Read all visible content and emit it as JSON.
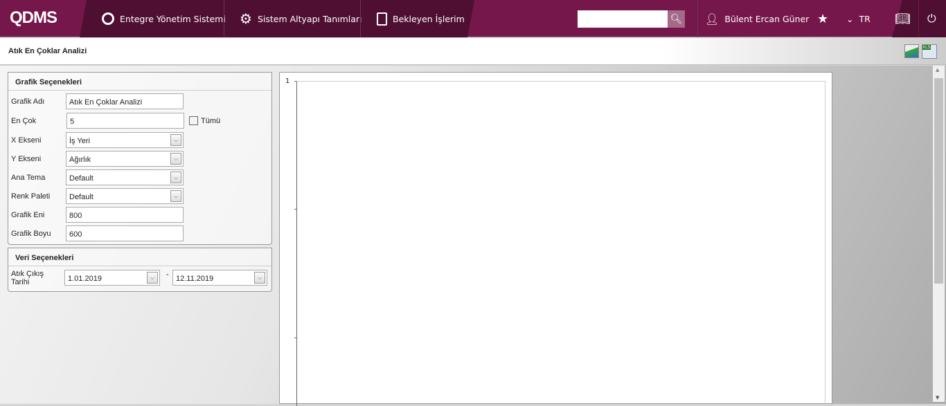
{
  "header": {
    "logo": "QDMS",
    "nav": [
      {
        "label": "Entegre Yönetim Sistemi",
        "icon": "q-icon"
      },
      {
        "label": "Sistem Altyapı Tanımları",
        "icon": "gear-icon"
      },
      {
        "label": "Bekleyen İşlerim",
        "icon": "clipboard-icon"
      }
    ],
    "search_value": "",
    "user": "Bülent Ercan Güner",
    "language": "TR"
  },
  "page": {
    "title": "Atık En Çoklar Analizi"
  },
  "grafik": {
    "heading": "Grafik Seçenekleri",
    "fields": [
      {
        "label": "Grafik Adı",
        "value": "Atık En Çoklar Analizi"
      },
      {
        "label": "En Çok",
        "value": "5"
      },
      {
        "label": "X Ekseni",
        "value": "İş Yeri"
      },
      {
        "label": "Y Ekseni",
        "value": "Ağırlık"
      },
      {
        "label": "Ana Tema",
        "value": "Default"
      },
      {
        "label": "Renk Paleti",
        "value": "Default"
      },
      {
        "label": "Grafik Eni",
        "value": "800"
      },
      {
        "label": "Grafik Boyu",
        "value": "600"
      }
    ],
    "all_label": "Tümü",
    "all_checked": false
  },
  "veri": {
    "heading": "Veri Seçenekleri",
    "date_label": "Atık Çıkış Tarihi",
    "start": "1.01.2019",
    "end": "12.11.2019",
    "sep": "-"
  },
  "chart_data": {
    "type": "bar",
    "categories": [],
    "values": [],
    "y_tick_top": "1"
  }
}
